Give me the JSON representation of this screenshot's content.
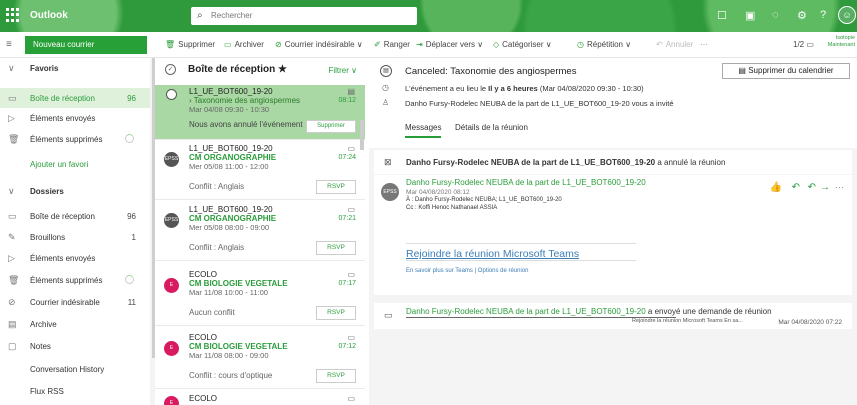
{
  "topbar": {
    "brand": "Outlook",
    "search_placeholder": "Rechercher",
    "right_note_1": "Isotopie",
    "right_note_2": "Maintenant"
  },
  "commands": {
    "new_mail": "Nouveau courrier",
    "delete": "Supprimer",
    "archive": "Archiver",
    "junk": "Courrier indésirable",
    "sweep": "Ranger",
    "move": "Déplacer vers",
    "categorize": "Catégoriser",
    "repeat": "Répétition",
    "undo": "Annuler",
    "more": "···",
    "pager": "1/2"
  },
  "nav": {
    "favorites_header": "Favoris",
    "favorites": [
      {
        "label": "Boîte de réception",
        "count": "96"
      },
      {
        "label": "Éléments envoyés",
        "count": ""
      },
      {
        "label": "Éléments supprimés",
        "count": ""
      }
    ],
    "add_favorite": "Ajouter un favori",
    "folders_header": "Dossiers",
    "folders": [
      {
        "label": "Boîte de réception",
        "count": "96"
      },
      {
        "label": "Brouillons",
        "count": "1"
      },
      {
        "label": "Éléments envoyés",
        "count": ""
      },
      {
        "label": "Éléments supprimés",
        "count": ""
      },
      {
        "label": "Courrier indésirable",
        "count": "11"
      },
      {
        "label": "Archive",
        "count": ""
      },
      {
        "label": "Notes",
        "count": ""
      },
      {
        "label": "Conversation History",
        "count": ""
      },
      {
        "label": "Flux RSS",
        "count": ""
      }
    ]
  },
  "list": {
    "title": "Boîte de réception ★",
    "filter": "Filtrer ∨",
    "messages": [
      {
        "from": "L1_UE_BOT600_19-20",
        "subject": "› Taxonomie des angiospermes",
        "when": "Mar 04/08 09:30 - 10:30",
        "time": "08:12",
        "note": "Nous avons annulé l'événement",
        "button": "Supprimer",
        "avatar": ""
      },
      {
        "from": "L1_UE_BOT600_19-20",
        "subject": "CM ORGANOGRAPHIE",
        "when": "Mer 05/08 11:00 - 12:00",
        "time": "07:24",
        "note": "Conflit : Anglais",
        "button": "RSVP",
        "avatar": "EPSS"
      },
      {
        "from": "L1_UE_BOT600_19-20",
        "subject": "CM ORGANOGRAPHIE",
        "when": "Mer 05/08 08:00 - 09:00",
        "time": "07:21",
        "note": "Conflit : Anglais",
        "button": "RSVP",
        "avatar": "EPSS"
      },
      {
        "from": "ECOLO",
        "subject": "CM BIOLOGIE VEGETALE",
        "when": "Mar 11/08 10:00 - 11:00",
        "time": "07:17",
        "note": "Aucun conflit",
        "button": "RSVP",
        "avatar": "E"
      },
      {
        "from": "ECOLO",
        "subject": "CM BIOLOGIE VEGETALE",
        "when": "Mar 11/08 08:00 - 09:00",
        "time": "07:12",
        "note": "Conflit : cours d'optique",
        "button": "RSVP",
        "avatar": "E"
      },
      {
        "from": "ECOLO",
        "subject": "",
        "when": "",
        "time": "",
        "note": "",
        "button": "",
        "avatar": "E"
      }
    ]
  },
  "reading": {
    "title": "Canceled: Taxonomie des angiospermes",
    "delete_calendar": "Supprimer du calendrier",
    "line1_pre": "L'événement a eu lieu le ",
    "line1_bold": "Il y a 6 heures",
    "line1_post": " (Mar 04/08/2020 09:30 - 10:30)",
    "line2": "Danho Fursy-Rodelec NEUBA de la part de L1_UE_BOT600_19-20 vous a invité",
    "tab_messages": "Messages",
    "tab_details": "Détails de la réunion",
    "notice_bold": "Danho Fursy-Rodelec NEUBA de la part de L1_UE_BOT600_19-20",
    "notice_rest": " a annulé la réunion",
    "mail": {
      "avatar": "EPSS",
      "sender": "Danho Fursy-Rodelec NEUBA de la part de L1_UE_BOT600_19-20",
      "date": "Mar 04/08/2020 08:12",
      "to": "À : Danho Fursy-Rodelec NEUBA; L1_UE_BOT600_19-20",
      "cc": "Cc : Koffi Henoc Nathanael ASSIA",
      "join": "Rejoindre la réunion Microsoft Teams",
      "learn": "En savoir plus sur Teams | Options de réunion"
    },
    "invite": {
      "link": "Danho Fursy-Rodelec NEUBA de la part de L1_UE_BOT600_19-20",
      "rest": " a envoyé une demande de réunion",
      "preview": "Rejoindre la réunion Microsoft Teams En sa...",
      "date": "Mar 04/08/2020 07:22"
    }
  },
  "colors": {
    "accent": "#2a9d3b",
    "topbar": "#2f9a3c",
    "selected_row": "#a9d8a4",
    "link": "#3c7eb6"
  }
}
